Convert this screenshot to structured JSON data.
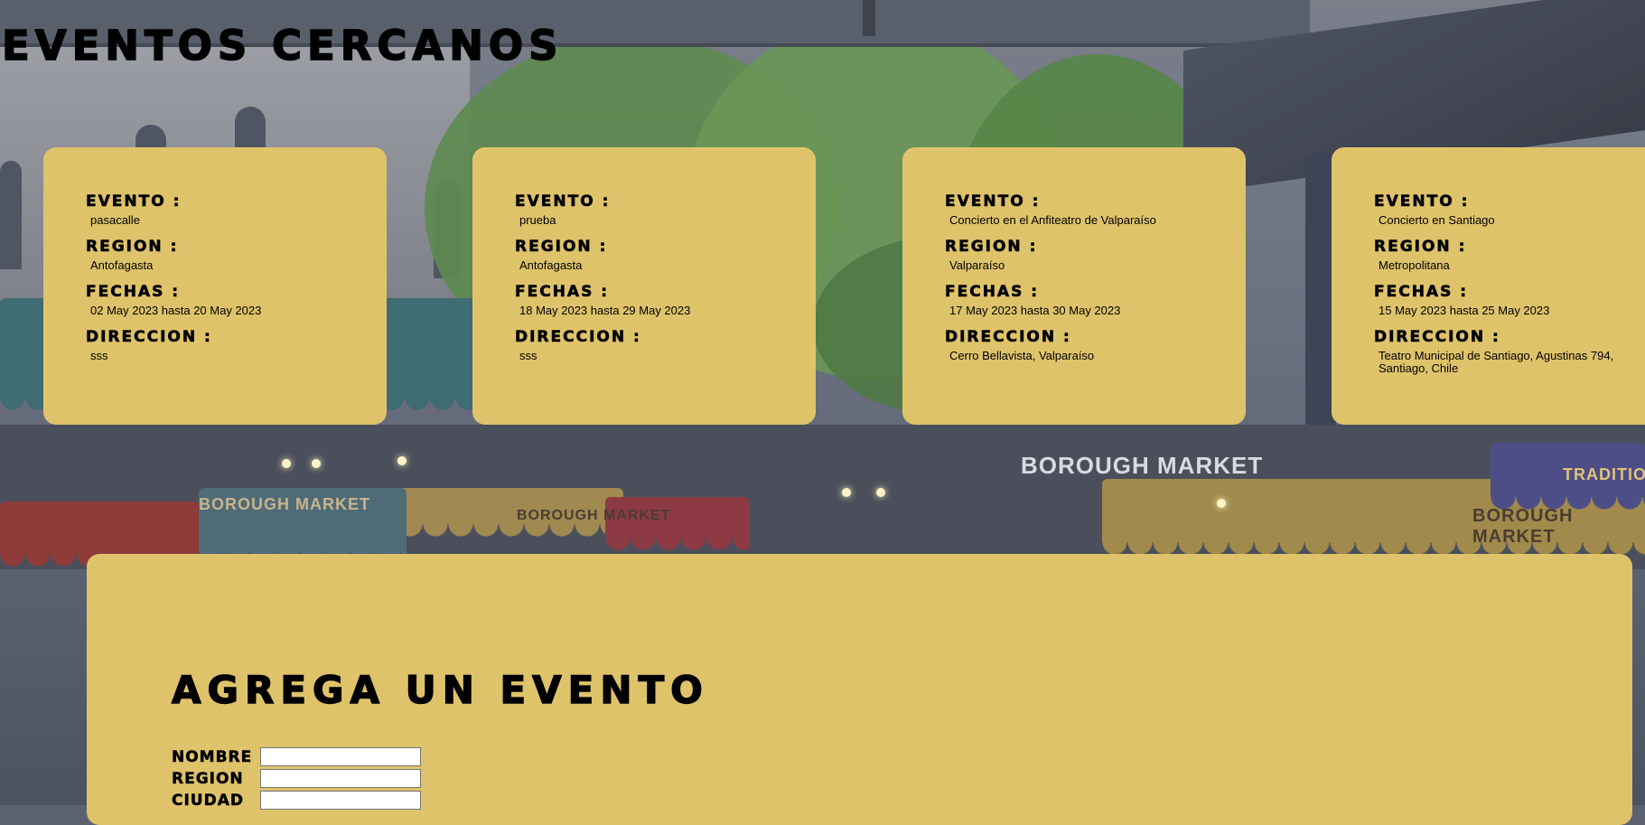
{
  "page_title": "EVENTOS CERCANOS",
  "labels": {
    "evento": "EVENTO :",
    "region": "REGION :",
    "fechas": "FECHAS :",
    "direccion": "DIRECCION :"
  },
  "events": [
    {
      "evento": "pasacalle",
      "region": "Antofagasta",
      "fechas": "02 May 2023 hasta 20 May 2023",
      "direccion": "sss"
    },
    {
      "evento": "prueba",
      "region": "Antofagasta",
      "fechas": "18 May 2023 hasta 29 May 2023",
      "direccion": "sss"
    },
    {
      "evento": "Concierto en el Anfiteatro de Valparaíso",
      "region": "Valparaíso",
      "fechas": "17 May 2023 hasta 30 May 2023",
      "direccion": "Cerro Bellavista, Valparaíso"
    },
    {
      "evento": "Concierto en Santiago",
      "region": "Metropolitana",
      "fechas": "15 May 2023 hasta 25 May 2023",
      "direccion": "Teatro Municipal de Santiago, Agustinas 794, Santiago, Chile"
    }
  ],
  "form": {
    "title": "AGREGA UN EVENTO",
    "fields": [
      {
        "label": "NOMBRE",
        "value": ""
      },
      {
        "label": "REGION",
        "value": ""
      },
      {
        "label": "CIUDAD",
        "value": ""
      }
    ]
  },
  "background_signs": [
    "BOROUGH MARKET",
    "BOROUGH MARKET",
    "BOROUGH MARKET",
    "BOROUGH MARKET",
    "TRADITIONAL"
  ],
  "colors": {
    "card": "#dfc36b",
    "text": "#000000"
  }
}
